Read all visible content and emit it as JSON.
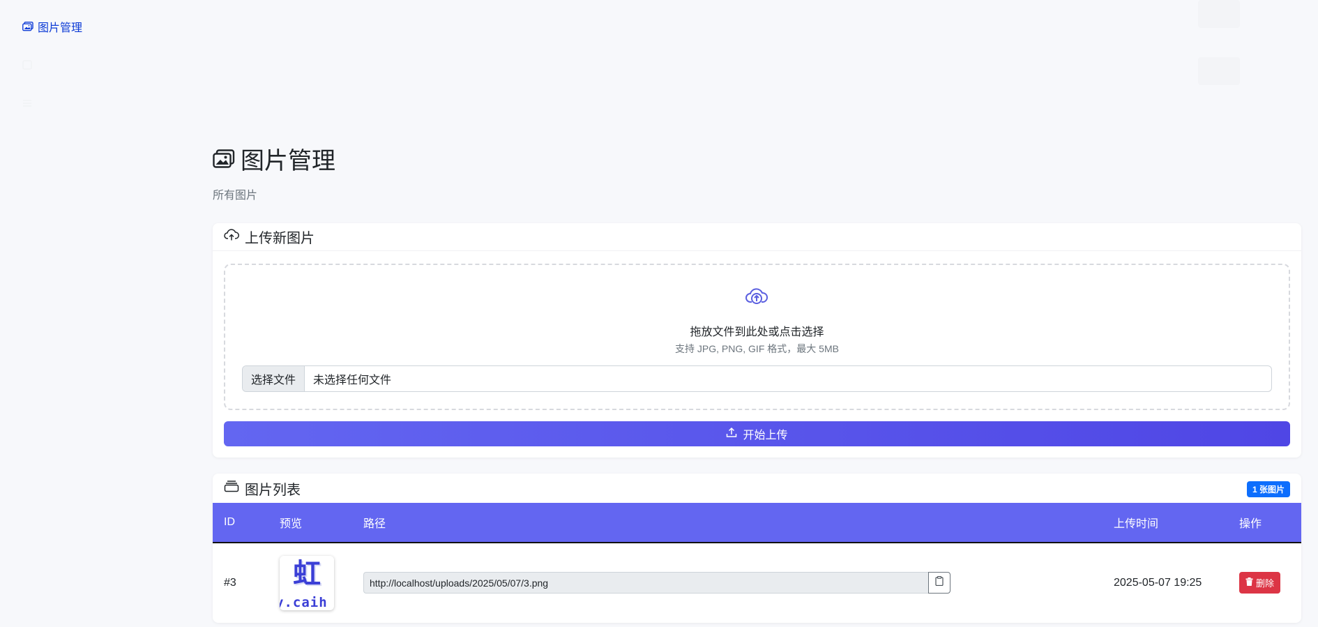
{
  "sidebar": {
    "items": [
      {
        "label": "图片管理",
        "icon": "images-icon",
        "active": true
      },
      {
        "label": "",
        "icon": "dashboard-icon",
        "active": false
      },
      {
        "label": "",
        "icon": "list-icon",
        "active": false
      }
    ]
  },
  "header": {
    "title": "图片管理",
    "subtitle": "所有图片"
  },
  "upload": {
    "title": "上传新图片",
    "drop_text": "拖放文件到此处或点击选择",
    "drop_hint": "支持 JPG, PNG, GIF 格式，最大 5MB",
    "file_button": "选择文件",
    "file_status": "未选择任何文件",
    "submit_label": "开始上传"
  },
  "list": {
    "title": "图片列表",
    "count_badge": "1 张图片",
    "columns": [
      "ID",
      "预览",
      "路径",
      "上传时间",
      "操作"
    ],
    "rows": [
      {
        "id": "#3",
        "preview_glyph": "虹",
        "preview_text": "y.caih",
        "path": "http://localhost/uploads/2025/05/07/3.png",
        "uploaded_at": "2025-05-07 19:25",
        "action_label": "删除"
      }
    ]
  },
  "colors": {
    "accent": "#6366f1",
    "accent_dark": "#4f46e5",
    "danger": "#dc3545",
    "badge": "#0d6efd",
    "active_nav": "#0d3bd6"
  }
}
